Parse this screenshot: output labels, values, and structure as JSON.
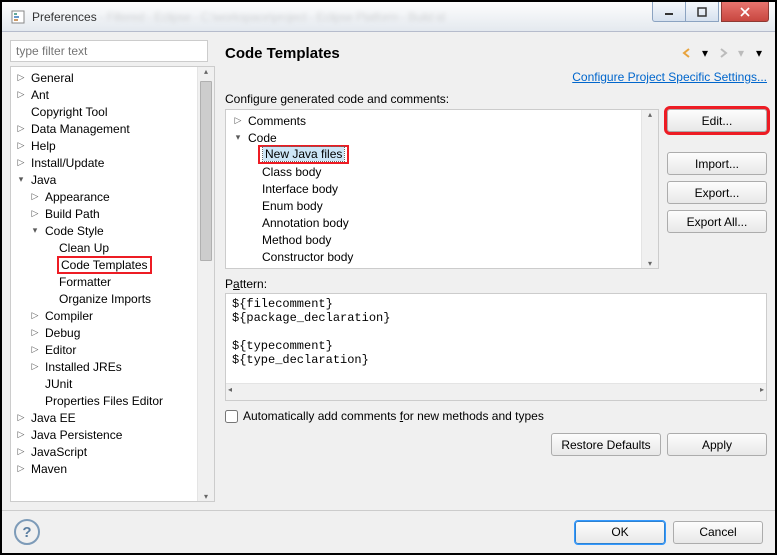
{
  "window": {
    "title": "Preferences"
  },
  "filter": {
    "placeholder": "type filter text"
  },
  "tree": {
    "items": [
      {
        "label": "General",
        "depth": 1,
        "arrow": "▷"
      },
      {
        "label": "Ant",
        "depth": 1,
        "arrow": "▷"
      },
      {
        "label": "Copyright Tool",
        "depth": 1,
        "arrow": ""
      },
      {
        "label": "Data Management",
        "depth": 1,
        "arrow": "▷"
      },
      {
        "label": "Help",
        "depth": 1,
        "arrow": "▷"
      },
      {
        "label": "Install/Update",
        "depth": 1,
        "arrow": "▷"
      },
      {
        "label": "Java",
        "depth": 1,
        "arrow": "▾"
      },
      {
        "label": "Appearance",
        "depth": 2,
        "arrow": "▷"
      },
      {
        "label": "Build Path",
        "depth": 2,
        "arrow": "▷"
      },
      {
        "label": "Code Style",
        "depth": 2,
        "arrow": "▾"
      },
      {
        "label": "Clean Up",
        "depth": 3,
        "arrow": ""
      },
      {
        "label": "Code Templates",
        "depth": 3,
        "arrow": "",
        "highlight": true
      },
      {
        "label": "Formatter",
        "depth": 3,
        "arrow": ""
      },
      {
        "label": "Organize Imports",
        "depth": 3,
        "arrow": ""
      },
      {
        "label": "Compiler",
        "depth": 2,
        "arrow": "▷"
      },
      {
        "label": "Debug",
        "depth": 2,
        "arrow": "▷"
      },
      {
        "label": "Editor",
        "depth": 2,
        "arrow": "▷"
      },
      {
        "label": "Installed JREs",
        "depth": 2,
        "arrow": "▷"
      },
      {
        "label": "JUnit",
        "depth": 2,
        "arrow": ""
      },
      {
        "label": "Properties Files Editor",
        "depth": 2,
        "arrow": ""
      },
      {
        "label": "Java EE",
        "depth": 1,
        "arrow": "▷"
      },
      {
        "label": "Java Persistence",
        "depth": 1,
        "arrow": "▷"
      },
      {
        "label": "JavaScript",
        "depth": 1,
        "arrow": "▷"
      },
      {
        "label": "Maven",
        "depth": 1,
        "arrow": "▷"
      }
    ]
  },
  "page": {
    "title": "Code Templates",
    "link": "Configure Project Specific Settings...",
    "configure_label": "Configure generated code and comments:",
    "pattern_label_pre": "P",
    "pattern_label_ul": "a",
    "pattern_label_post": "ttern:",
    "pattern_text": "${filecomment}\n${package_declaration}\n\n${typecomment}\n${type_declaration}",
    "checkbox_pre": "Automatically add comments ",
    "checkbox_ul": "f",
    "checkbox_post": "or new methods and types"
  },
  "templates": {
    "items": [
      {
        "label": "Comments",
        "depth": 1,
        "arrow": "▷"
      },
      {
        "label": "Code",
        "depth": 1,
        "arrow": "▾"
      },
      {
        "label": "New Java files",
        "depth": 2,
        "arrow": "",
        "selected": true,
        "highlight": true
      },
      {
        "label": "Class body",
        "depth": 2,
        "arrow": ""
      },
      {
        "label": "Interface body",
        "depth": 2,
        "arrow": ""
      },
      {
        "label": "Enum body",
        "depth": 2,
        "arrow": ""
      },
      {
        "label": "Annotation body",
        "depth": 2,
        "arrow": ""
      },
      {
        "label": "Method body",
        "depth": 2,
        "arrow": ""
      },
      {
        "label": "Constructor body",
        "depth": 2,
        "arrow": ""
      }
    ]
  },
  "buttons": {
    "edit": "Edit...",
    "import": "Import...",
    "export": "Export...",
    "export_all": "Export All...",
    "restore": "Restore Defaults",
    "apply": "Apply",
    "ok": "OK",
    "cancel": "Cancel"
  }
}
